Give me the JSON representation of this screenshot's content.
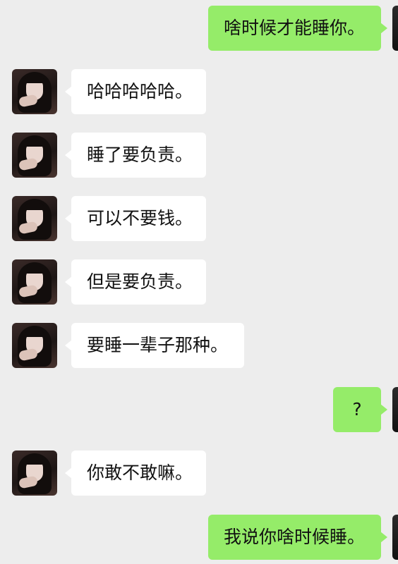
{
  "messages": [
    {
      "side": "out",
      "text": "啥时候才能睡你。"
    },
    {
      "side": "in",
      "text": "哈哈哈哈哈。"
    },
    {
      "side": "in",
      "text": "睡了要负责。"
    },
    {
      "side": "in",
      "text": "可以不要钱。"
    },
    {
      "side": "in",
      "text": "但是要负责。"
    },
    {
      "side": "in",
      "text": "要睡一辈子那种。"
    },
    {
      "side": "out",
      "text": "?"
    },
    {
      "side": "in",
      "text": "你敢不敢嘛。"
    },
    {
      "side": "out",
      "text": "我说你啥时候睡。"
    }
  ],
  "colors": {
    "background": "#ededed",
    "incoming_bubble": "#ffffff",
    "outgoing_bubble": "#95ec69"
  },
  "icons": {
    "contact_avatar": "contact-avatar-icon",
    "self_avatar": "self-avatar-icon"
  }
}
